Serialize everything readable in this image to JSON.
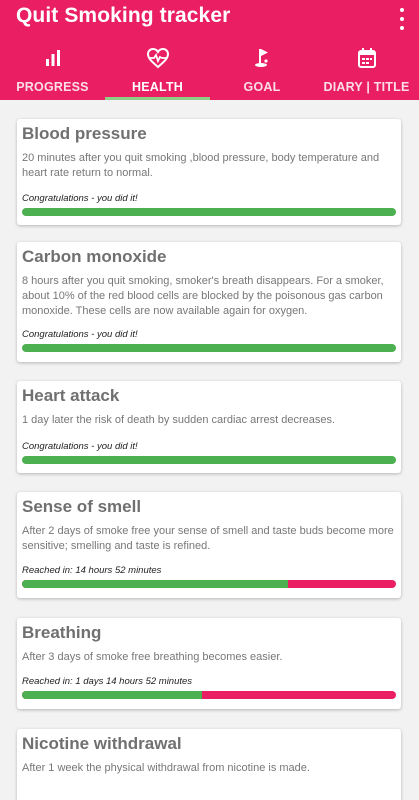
{
  "app": {
    "title": "Quit Smoking tracker",
    "accent_color": "#ea1e63",
    "progress_color": "#4caf50"
  },
  "tabs": [
    {
      "label": "PROGRESS",
      "icon": "bar-chart-icon",
      "active": false
    },
    {
      "label": "HEALTH",
      "icon": "heart-pulse-icon",
      "active": true
    },
    {
      "label": "GOAL",
      "icon": "golf-flag-icon",
      "active": false
    },
    {
      "label": "DIARY | TITLE",
      "icon": "calendar-icon",
      "active": false
    }
  ],
  "cards": [
    {
      "title": "Blood pressure",
      "description": "20 minutes after you quit smoking ,blood pressure, body temperature and heart rate return to normal.",
      "status": "Congratulations - you did it!",
      "progress": 1.0
    },
    {
      "title": "Carbon monoxide",
      "description": "8 hours after you quit smoking, smoker's breath disappears. For a smoker, about 10% of the red blood cells are blocked by the poisonous gas carbon monoxide. These cells are now available again for oxygen.",
      "status": "Congratulations - you did it!",
      "progress": 1.0
    },
    {
      "title": "Heart attack",
      "description": "1 day later the risk of death by sudden cardiac arrest decreases.",
      "status": "Congratulations - you did it!",
      "progress": 1.0
    },
    {
      "title": "Sense of smell",
      "description": "After 2 days of smoke free your sense of smell and taste buds become more sensitive; smelling and taste is refined.",
      "status": "Reached in: 14 hours 52 minutes",
      "progress": 0.71
    },
    {
      "title": "Breathing",
      "description": "After 3 days of smoke free breathing becomes easier.",
      "status": "Reached in: 1 days 14 hours 52 minutes",
      "progress": 0.48
    },
    {
      "title": "Nicotine withdrawal",
      "description": "After 1 week the physical withdrawal from nicotine is made.",
      "status": "",
      "progress": null
    }
  ]
}
